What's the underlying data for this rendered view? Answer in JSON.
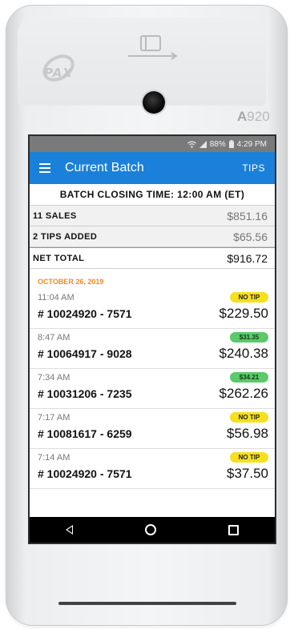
{
  "device": {
    "brand": "PAX",
    "model_prefix": "A",
    "model_number": "920"
  },
  "status_bar": {
    "battery": "88%",
    "time": "4:29 PM"
  },
  "app_bar": {
    "title": "Current Batch",
    "action_label": "TIPS"
  },
  "batch": {
    "closing_time": "BATCH CLOSING TIME: 12:00 AM (ET)",
    "summary": [
      {
        "label": "11 SALES",
        "value": "$851.16"
      },
      {
        "label": "2 TIPS ADDED",
        "value": "$65.56"
      },
      {
        "label": "NET TOTAL",
        "value": "$916.72"
      }
    ]
  },
  "list": {
    "date_header": "OCTOBER 26, 2019",
    "transactions": [
      {
        "time": "11:04 AM",
        "badge": "NO TIP",
        "badge_color": "#f6e01d",
        "number": "# 10024920 - 7571",
        "amount": "$229.50"
      },
      {
        "time": "8:47 AM",
        "badge": "$31.35",
        "badge_color": "#5cc96a",
        "number": "# 10064917 - 9028",
        "amount": "$240.38"
      },
      {
        "time": "7:34 AM",
        "badge": "$34.21",
        "badge_color": "#5cc96a",
        "number": "# 10031206 - 7235",
        "amount": "$262.26"
      },
      {
        "time": "7:17 AM",
        "badge": "NO TIP",
        "badge_color": "#f6e01d",
        "number": "# 10081617 - 6259",
        "amount": "$56.98"
      },
      {
        "time": "7:14 AM",
        "badge": "NO TIP",
        "badge_color": "#f6e01d",
        "number": "# 10024920 - 7571",
        "amount": "$37.50"
      }
    ]
  },
  "colors": {
    "app_bar": "#1a80d9",
    "date_header": "#f28c28"
  },
  "icons": [
    "wifi-icon",
    "signal-icon",
    "battery-icon",
    "menu-icon",
    "back-icon",
    "home-icon",
    "recents-icon",
    "card-reader-icon",
    "camera-icon"
  ]
}
